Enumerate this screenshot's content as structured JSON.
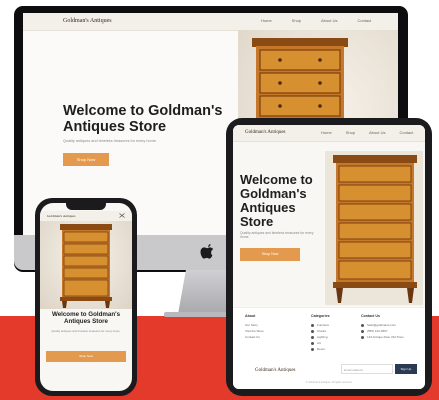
{
  "colors": {
    "red_band": "#e33a2c",
    "accent": "#e39a4e",
    "wood_dark": "#7c3f0e",
    "wood_light": "#d7882f"
  },
  "site": {
    "logo": "Goldman's Antiques",
    "nav": [
      "Home",
      "Shop",
      "About Us",
      "Contact"
    ],
    "hero_title": "Welcome to Goldman's Antiques Store",
    "hero_subtitle": "Quality antiques and timeless treasures for every home.",
    "hero_button": "Shop Now"
  },
  "footer": {
    "col1_title": "About",
    "col1_items": [
      "Our Story",
      "Visit the Store",
      "Contact Us"
    ],
    "col2_title": "Categories",
    "col2_items": [
      "Furniture",
      "Clocks",
      "Lighting",
      "Art",
      "Decor"
    ],
    "col3_title": "Contact Us",
    "col3_items": [
      "hello@goldmans.com",
      "(555) 123-4567",
      "123 Antique Row, Old Town"
    ],
    "email_placeholder": "Email address",
    "signup_button": "Sign Up",
    "copyright": "© Goldman's Antiques. All rights reserved."
  },
  "icons": {
    "apple": "apple-logo-icon",
    "menu": "close-icon"
  }
}
